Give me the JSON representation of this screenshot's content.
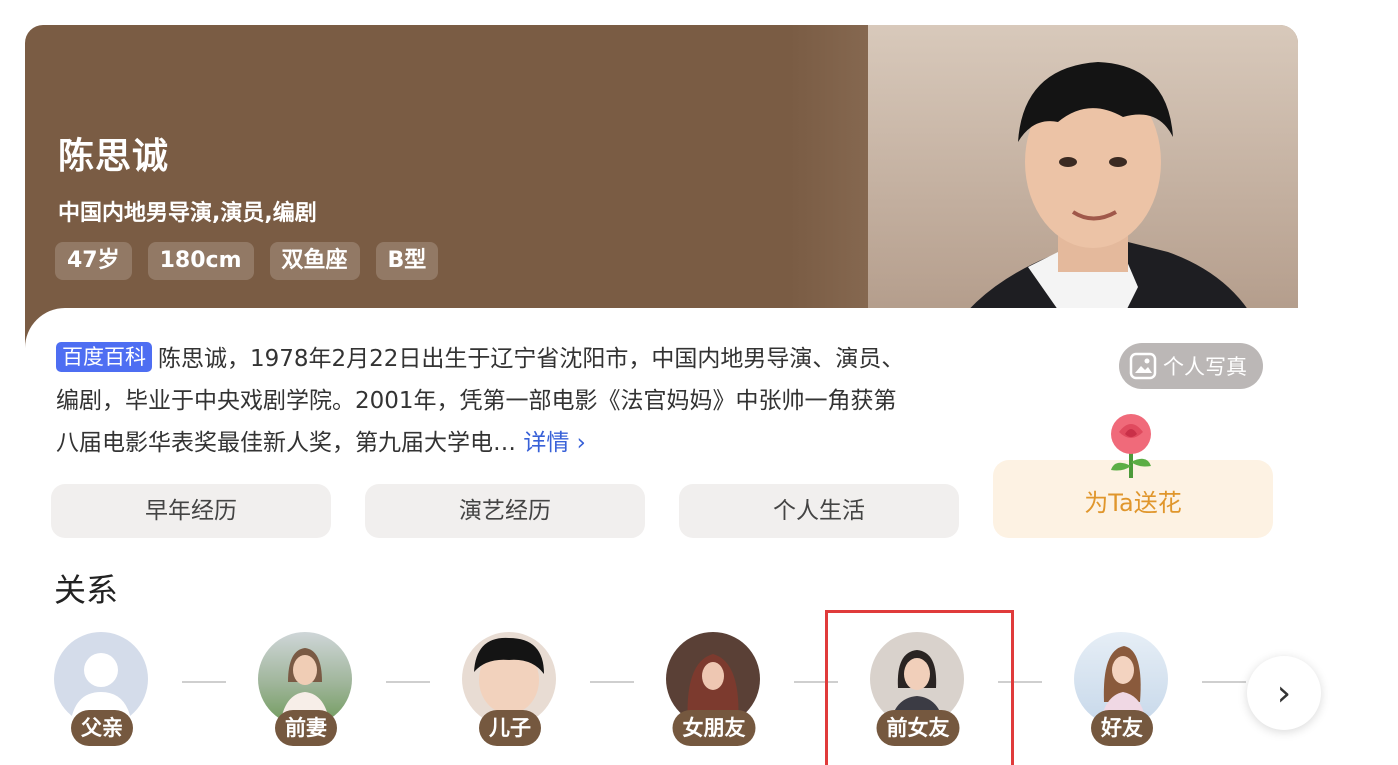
{
  "profile": {
    "name": "陈思诚",
    "occupation": "中国内地男导演,演员,编剧",
    "tags": [
      "47岁",
      "180cm",
      "双鱼座",
      "B型"
    ],
    "photo_button": "个人写真"
  },
  "summary": {
    "badge": "百度百科",
    "text": "陈思诚，1978年2月22日出生于辽宁省沈阳市，中国内地男导演、演员、编剧，毕业于中央戏剧学院。2001年，凭第一部电影《法官妈妈》中张帅一角获第八届电影华表奖最佳新人奖，第九届大学电…",
    "more": "详情 ›"
  },
  "sections": [
    "早年经历",
    "演艺经历",
    "个人生活"
  ],
  "flower_button": "为Ta送花",
  "relations": {
    "title": "关系",
    "items": [
      {
        "label": "父亲"
      },
      {
        "label": "前妻"
      },
      {
        "label": "儿子"
      },
      {
        "label": "女朋友"
      },
      {
        "label": "前女友"
      },
      {
        "label": "好友"
      }
    ]
  },
  "colors": {
    "hero_brown": "#7a5c44",
    "label_brown": "#75583f",
    "badge_blue": "#4e6ef2",
    "link_blue": "#3861d8",
    "flower_text": "#e0962c",
    "highlight_red": "#e03b3b"
  },
  "icons": [
    "photo-icon",
    "rose-icon",
    "chevron-right-icon",
    "default-avatar-icon"
  ]
}
